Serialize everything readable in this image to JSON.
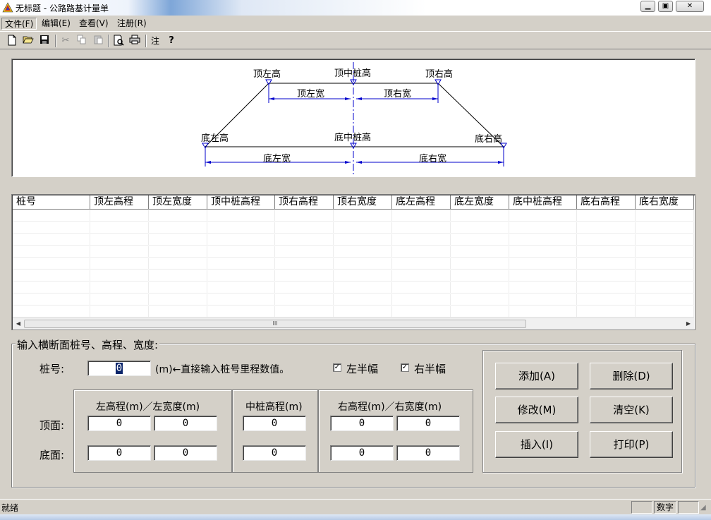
{
  "window": {
    "title": "无标题 - 公路路基计量单"
  },
  "menu": [
    {
      "label": "文件(F)"
    },
    {
      "label": "编辑(E)"
    },
    {
      "label": "查看(V)"
    },
    {
      "label": "注册(R)"
    }
  ],
  "toolbar": {
    "note_label": "注",
    "help_label": "?"
  },
  "diagram": {
    "top_left_height": "顶左高",
    "top_center_height": "顶中桩高",
    "top_right_height": "顶右高",
    "top_left_width": "顶左宽",
    "top_right_width": "顶右宽",
    "bottom_left_height": "底左高",
    "bottom_center_height": "底中桩高",
    "bottom_right_height": "底右高",
    "bottom_left_width": "底左宽",
    "bottom_right_width": "底右宽"
  },
  "table": {
    "columns": [
      "桩号",
      "顶左高程",
      "顶左宽度",
      "顶中桩高程",
      "顶右高程",
      "顶右宽度",
      "底左高程",
      "底左宽度",
      "底中桩高程",
      "底右高程",
      "底右宽度"
    ],
    "scroll_grip": "III"
  },
  "form": {
    "group_title": "输入横断面桩号、高程、宽度:",
    "station_label": "桩号:",
    "station_value": "0",
    "station_hint": "(m)←直接输入桩号里程数值。",
    "left_half_label": "左半幅",
    "right_half_label": "右半幅",
    "left_half_checked": true,
    "right_half_checked": true,
    "left_header": "左高程(m)／左宽度(m)",
    "center_header": "中桩高程(m)",
    "right_header": "右高程(m)／右宽度(m)",
    "top_row_label": "顶面:",
    "bottom_row_label": "底面:",
    "top_left_elev": "0",
    "top_left_width": "0",
    "top_center_elev": "0",
    "top_right_elev": "0",
    "top_right_width": "0",
    "bottom_left_elev": "0",
    "bottom_left_width": "0",
    "bottom_center_elev": "0",
    "bottom_right_elev": "0",
    "bottom_right_width": "0"
  },
  "buttons": {
    "add": "添加(A)",
    "delete": "删除(D)",
    "modify": "修改(M)",
    "clear": "清空(K)",
    "insert": "插入(I)",
    "print": "打印(P)"
  },
  "status": {
    "ready": "就绪",
    "numlock": "数字"
  }
}
